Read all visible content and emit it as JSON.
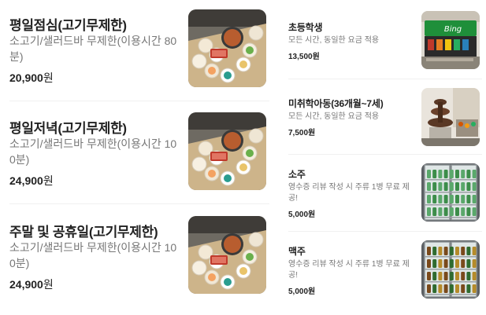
{
  "menu_left": [
    {
      "name": "평일점심(고기무제한)",
      "desc": "소고기/샐러드바 무제한(이용시간 80분)",
      "price": "20,900",
      "unit": "원",
      "image": "hotpot-buffet-table-photo"
    },
    {
      "name": "평일저녁(고기무제한)",
      "desc": "소고기/샐러드바 무제한(이용시간 100분)",
      "price": "24,900",
      "unit": "원",
      "image": "hotpot-buffet-table-photo"
    },
    {
      "name": "주말 및 공휴일(고기무제한)",
      "desc": "소고기/샐러드바 무제한(이용시간 100분)",
      "price": "24,900",
      "unit": "원",
      "image": "hotpot-buffet-table-photo"
    }
  ],
  "menu_right": [
    {
      "name": "초등학생",
      "desc": "모든 시간, 동일한 요금 적용",
      "price": "13,500원",
      "image": "drink-dispenser-photo"
    },
    {
      "name": "미취학아동(36개월~7세)",
      "desc": "모든 시간, 동일한 요금 적용",
      "price": "7,500원",
      "image": "chocolate-fountain-photo"
    },
    {
      "name": "소주",
      "desc": "영수증 리뷰 작성 시 주류 1병 무료 제공!",
      "price": "5,000원",
      "image": "soju-fridge-photo"
    },
    {
      "name": "맥주",
      "desc": "영수증 리뷰 작성 시 주류 1병 무료 제공!",
      "price": "5,000원",
      "image": "beer-fridge-photo"
    }
  ]
}
